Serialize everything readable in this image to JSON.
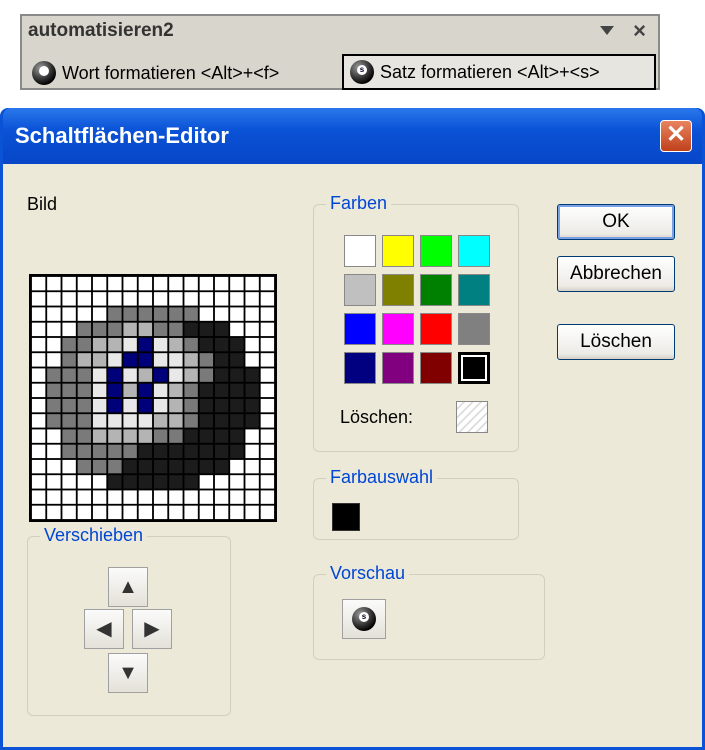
{
  "toolbar": {
    "title": "automatisieren2",
    "buttons": [
      {
        "label": "Wort formatieren <Alt>+<f>",
        "badge": "",
        "icon": "ball-icon"
      },
      {
        "label": "Satz formatieren <Alt>+<s>",
        "badge": "s",
        "icon": "ball-s-icon"
      }
    ]
  },
  "dialog": {
    "title": "Schaltflächen-Editor",
    "image_label": "Bild",
    "colors_group": "Farben",
    "clear_label": "Löschen:",
    "selection_group": "Farbauswahl",
    "move_group": "Verschieben",
    "preview_group": "Vorschau",
    "buttons": {
      "ok": "OK",
      "cancel": "Abbrechen",
      "clear": "Löschen"
    },
    "palette": [
      "#ffffff",
      "#ffff00",
      "#00ff00",
      "#00ffff",
      "#c0c0c0",
      "#808000",
      "#008000",
      "#008080",
      "#0000ff",
      "#ff00ff",
      "#ff0000",
      "#808080",
      "#000080",
      "#800080",
      "#800000",
      "#000000"
    ],
    "selected_color": "#000000",
    "arrows": {
      "up": "▲",
      "left": "◀",
      "right": "▶",
      "down": "▼"
    }
  }
}
